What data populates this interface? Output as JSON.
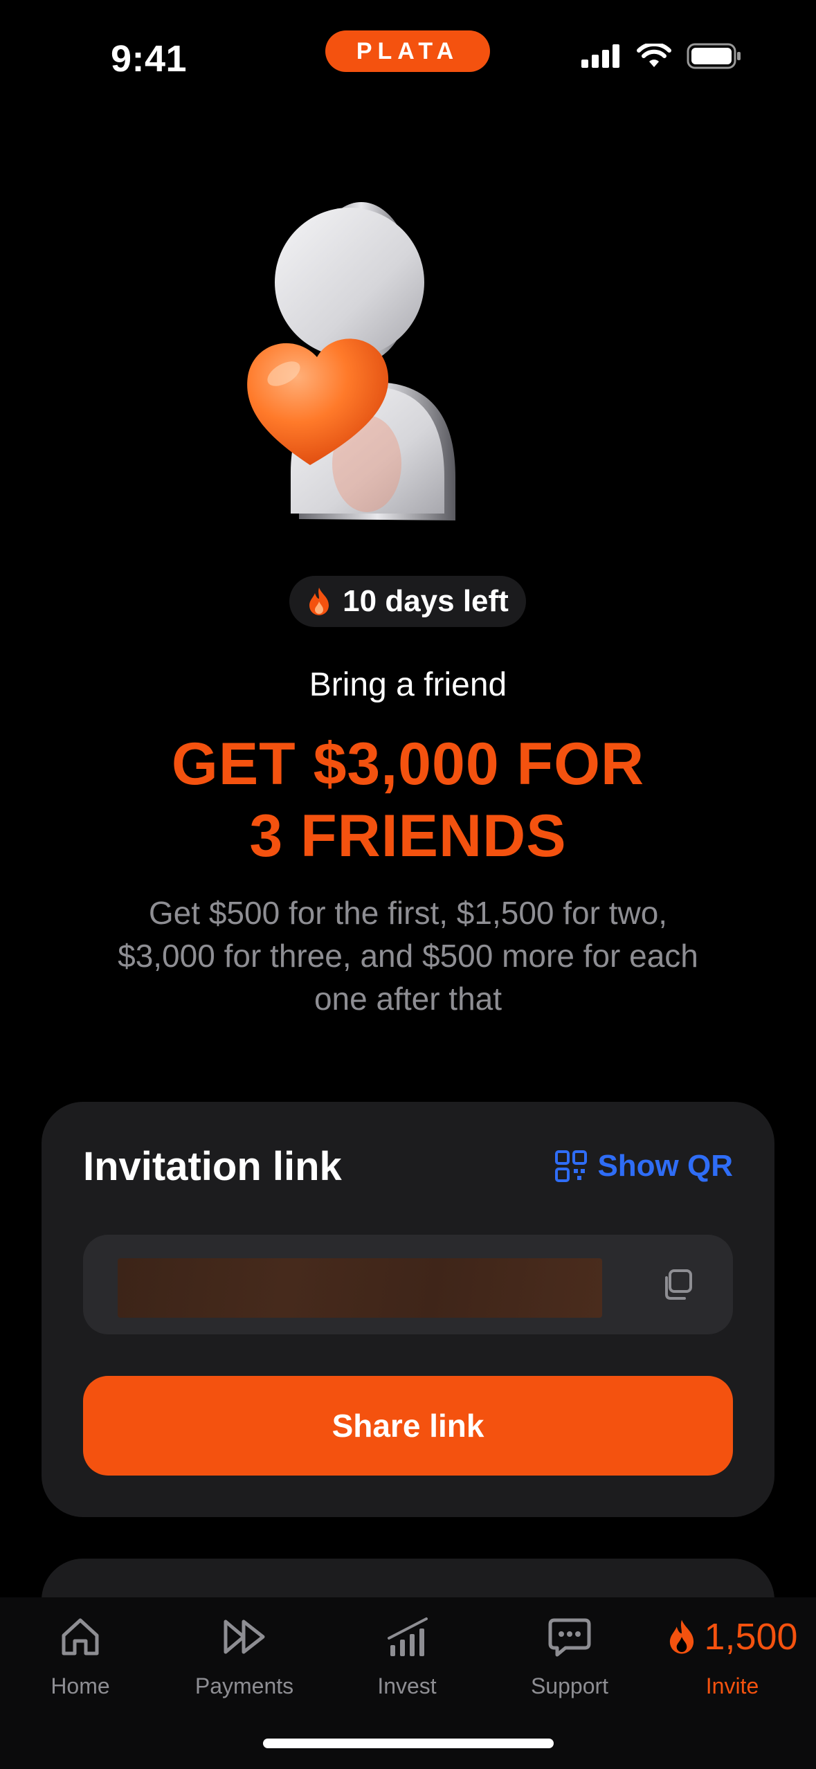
{
  "status_bar": {
    "time": "9:41",
    "brand": "PLATA"
  },
  "promo": {
    "timer": "10 days left",
    "subtitle": "Bring a friend",
    "headline_line1": "GET $3,000 FOR",
    "headline_line2": "3 FRIENDS",
    "description": "Get $500 for the first, $1,500 for two, $3,000 for three, and $500 more for each one after that"
  },
  "invitation": {
    "title": "Invitation link",
    "show_qr_label": "Show QR",
    "share_label": "Share link"
  },
  "tab_bar": {
    "tabs": [
      {
        "label": "Home",
        "icon": "home-icon"
      },
      {
        "label": "Payments",
        "icon": "payments-icon"
      },
      {
        "label": "Invest",
        "icon": "invest-icon"
      },
      {
        "label": "Support",
        "icon": "support-icon"
      },
      {
        "label": "Invite",
        "icon": "flame-icon",
        "amount": "1,500"
      }
    ],
    "active": "Invite"
  },
  "colors": {
    "accent": "#f4520f",
    "link": "#2f6df6",
    "card": "#1c1c1e",
    "muted": "#8e8e93"
  }
}
